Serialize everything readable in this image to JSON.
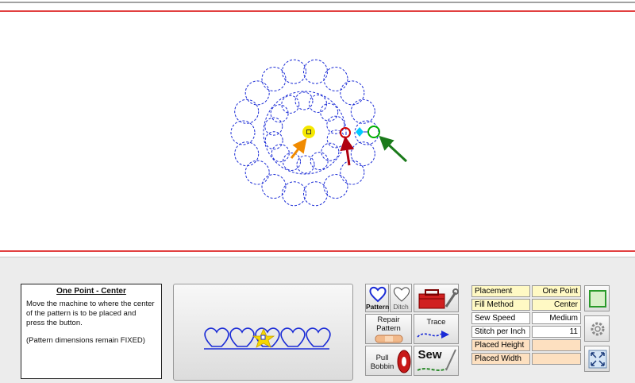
{
  "info": {
    "title": "One Point - Center",
    "line1": "Move the machine to where the center of the pattern is to be placed and press the button.",
    "line2": "(Pattern dimensions remain FIXED)"
  },
  "tools": {
    "pattern_label": "Pattern",
    "ditch_label": "Ditch",
    "repair_label_1": "Repair",
    "repair_label_2": "Pattern",
    "trace_label": "Trace",
    "pull_label_1": "Pull",
    "pull_label_2": "Bobbin",
    "sew_label": "Sew"
  },
  "settings": [
    {
      "label": "Placement",
      "value": "One Point"
    },
    {
      "label": "Fill Method",
      "value": "Center"
    },
    {
      "label": "Sew Speed",
      "value": "Medium"
    },
    {
      "label": "Stitch per Inch",
      "value": "11"
    },
    {
      "label": "Placed Height",
      "value": ""
    },
    {
      "label": "Placed Width",
      "value": ""
    }
  ],
  "icons": {
    "pattern_center": "yellow-center-marker",
    "start_point": "red-circle-marker",
    "end_point": "green-circle-marker",
    "join_point": "cyan-diamond-marker",
    "toolbox": "toolbox-icon",
    "gear": "gear-icon",
    "resize": "resize-icon",
    "frame": "frame-icon"
  },
  "colors": {
    "stitch": "#1a2bd6",
    "boundary": "#e00000",
    "setting_label_bg": "#fff9c4",
    "setting_empty_bg": "#fde0c0"
  }
}
